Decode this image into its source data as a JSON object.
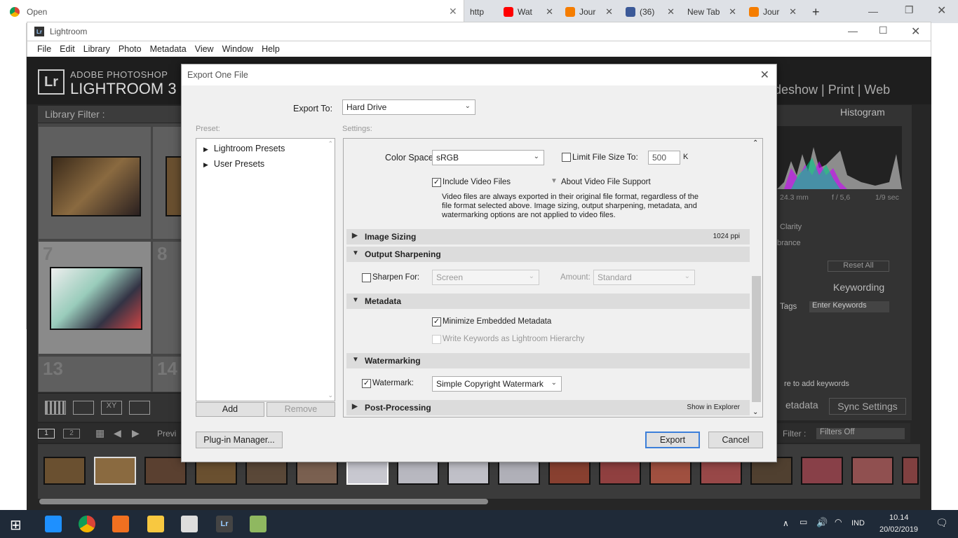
{
  "chrome": {
    "active_tab": "Open",
    "tabs": [
      {
        "label": "http",
        "color": "#888888"
      },
      {
        "label": "Wat",
        "color": "#ff0000"
      },
      {
        "label": "Jour",
        "color": "#f57d00"
      },
      {
        "label": "(36)",
        "color": "#3b5998"
      },
      {
        "label": "New Tab",
        "color": ""
      },
      {
        "label": "Jour",
        "color": "#f57d00"
      }
    ],
    "new_tab": "+"
  },
  "lightroom": {
    "window_title": "Lightroom",
    "menu": [
      "File",
      "Edit",
      "Library",
      "Photo",
      "Metadata",
      "View",
      "Window",
      "Help"
    ],
    "brand_top": "ADOBE PHOTOSHOP",
    "brand_name": "LIGHTROOM 3",
    "logo": "Lr",
    "modules": "deshow  |  Print  |  Web",
    "library_filter": "Library Filter :",
    "histogram": "Histogram",
    "hist_readout": [
      "24.3 mm",
      "f / 5,6",
      "1/9 sec"
    ],
    "quick_dev": [
      "Clarity",
      "brance"
    ],
    "reset_all": "Reset All",
    "keywording": "Keywording",
    "tags": "Tags",
    "enter_keywords": "Enter Keywords",
    "click_keywords": "re to add keywords",
    "metadata_btn": "etadata",
    "sync_settings": "Sync Settings",
    "filter_label": "Filter :",
    "filters_off": "Filters Off",
    "prev": "Previ",
    "grid_numbers": [
      "7",
      "8",
      "13",
      "14"
    ],
    "page_btns": [
      "1",
      "2"
    ]
  },
  "dialog": {
    "title": "Export One File",
    "export_to_label": "Export To:",
    "export_to_value": "Hard Drive",
    "preset_label": "Preset:",
    "settings_label": "Settings:",
    "presets": [
      "Lightroom Presets",
      "User Presets"
    ],
    "add": "Add",
    "remove": "Remove",
    "color_space_label": "Color Space:",
    "color_space_value": "sRGB",
    "limit_file_size": "Limit File Size To:",
    "limit_value": "500",
    "limit_unit": "K",
    "include_video": "Include Video Files",
    "about_video": "About Video File Support",
    "video_note_1": "Video files are always exported in their original file format, regardless of the",
    "video_note_2": "file format selected above. Image sizing, output sharpening, metadata, and",
    "video_note_3": "watermarking options are not applied to video files.",
    "sections": {
      "image_sizing": "Image Sizing",
      "image_sizing_right": "1024 ppi",
      "output_sharpening": "Output Sharpening",
      "metadata": "Metadata",
      "watermarking": "Watermarking",
      "post_processing": "Post-Processing",
      "post_processing_right": "Show in Explorer"
    },
    "sharpen_for": "Sharpen For:",
    "sharpen_value": "Screen",
    "amount_label": "Amount:",
    "amount_value": "Standard",
    "minimize_metadata": "Minimize Embedded Metadata",
    "write_keywords": "Write Keywords as Lightroom Hierarchy",
    "watermark_label": "Watermark:",
    "watermark_value": "Simple Copyright Watermark",
    "plugin_manager": "Plug-in Manager...",
    "export": "Export",
    "cancel": "Cancel"
  },
  "taskbar": {
    "lang": "IND",
    "time": "10.14",
    "date": "20/02/2019"
  }
}
